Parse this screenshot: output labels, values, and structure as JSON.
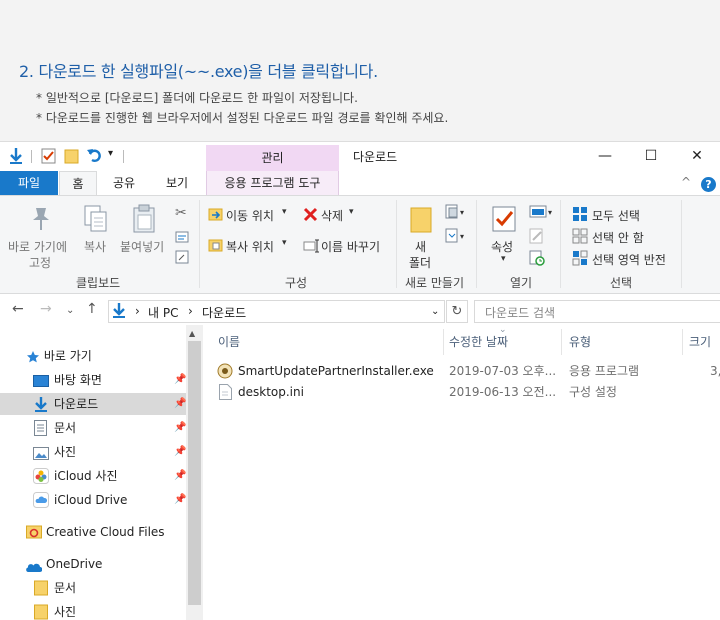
{
  "instruction": {
    "title": "2. 다운로드 한 실행파일(~~.exe)을 더블 클릭합니다.",
    "notes": [
      "* 일반적으로 [다운로드] 폴더에 다운로드 한 파일이 저장됩니다.",
      "* 다운로드를 진행한 웹 브라우저에서 설정된 다운로드 파일 경로를 확인해 주세요."
    ]
  },
  "window": {
    "title": "다운로드",
    "context_tab_group": "관리",
    "controls": {
      "minimize": "—",
      "maximize": "☐",
      "close": "✕"
    }
  },
  "ribbon_tabs": {
    "file": "파일",
    "home": "홈",
    "share": "공유",
    "view": "보기",
    "app_tools": "응용 프로그램 도구"
  },
  "ribbon": {
    "clipboard": {
      "pin_quick_access": [
        "바로 가기에",
        "고정"
      ],
      "copy": "복사",
      "paste": "붙여넣기",
      "label": "클립보드"
    },
    "organize": {
      "move_to": "이동 위치",
      "copy_to": "복사 위치",
      "delete": "삭제",
      "rename": "이름 바꾸기",
      "label": "구성"
    },
    "new": {
      "new_folder": [
        "새",
        "폴더"
      ],
      "label": "새로 만들기"
    },
    "open": {
      "properties": "속성",
      "label": "열기"
    },
    "select": {
      "select_all": "모두 선택",
      "select_none": "선택 안 함",
      "invert": "선택 영역 반전",
      "label": "선택"
    }
  },
  "address": {
    "crumbs": [
      "내 PC",
      "다운로드"
    ],
    "search_placeholder": "다운로드 검색"
  },
  "nav_pane": {
    "quick_access": "바로 가기",
    "items": [
      {
        "label": "바탕 화면",
        "icon": "desktop-icon"
      },
      {
        "label": "다운로드",
        "icon": "downloads-icon",
        "selected": true
      },
      {
        "label": "문서",
        "icon": "document-icon"
      },
      {
        "label": "사진",
        "icon": "pictures-icon"
      },
      {
        "label": "iCloud 사진",
        "icon": "icloud-photos-icon"
      },
      {
        "label": "iCloud Drive",
        "icon": "icloud-drive-icon"
      }
    ],
    "creative_cloud": "Creative Cloud Files",
    "onedrive": "OneDrive",
    "onedrive_items": [
      "문서",
      "사진"
    ]
  },
  "file_list": {
    "columns": [
      "이름",
      "수정한 날짜",
      "유형",
      "크기"
    ],
    "rows": [
      {
        "name": "SmartUpdatePartnerInstaller.exe",
        "date": "2019-07-03 오후...",
        "type": "응용 프로그램",
        "size": "3,",
        "icon": "installer-icon"
      },
      {
        "name": "desktop.ini",
        "date": "2019-06-13 오전...",
        "type": "구성 설정",
        "size": "",
        "icon": "ini-file-icon"
      }
    ]
  },
  "colors": {
    "accent": "#1979ca",
    "title_blue": "#1f5fa8",
    "context_tab": "#f1d8f3",
    "selected_row": "#d9d9d9"
  }
}
